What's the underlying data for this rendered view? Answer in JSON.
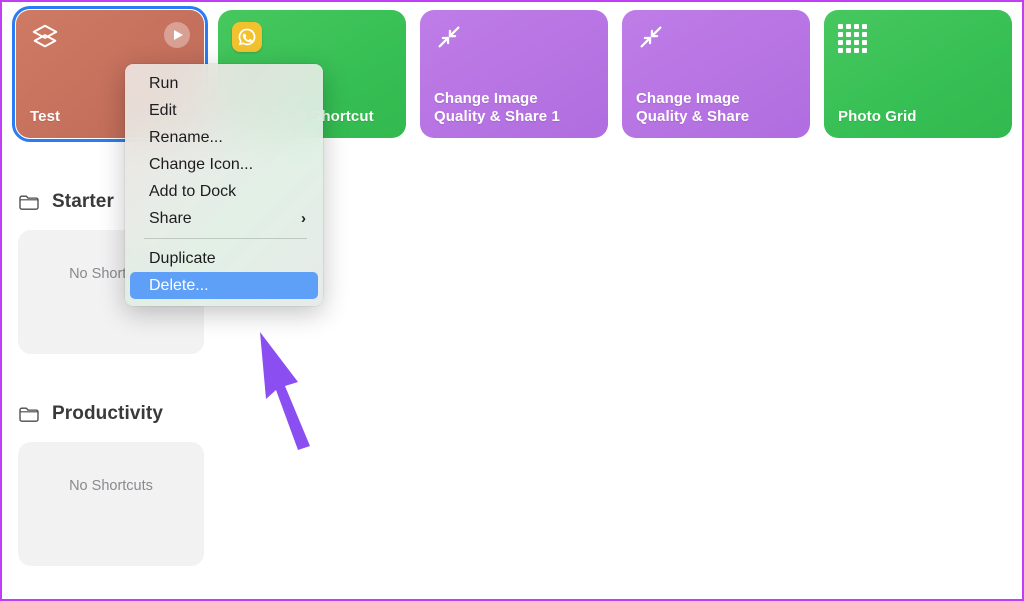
{
  "window": {
    "border_color": "#c13ef5",
    "background": "#ffffff"
  },
  "shortcuts": [
    {
      "title": "Test",
      "color": "#c4705c",
      "color_name": "salmon",
      "icon": "layers-icon",
      "badge": "play-icon",
      "selected": true
    },
    {
      "title": "WhatsApp Shortcut",
      "color": "#36bf54",
      "color_name": "green",
      "icon": "whatsapp-icon",
      "badge": "",
      "selected": false
    },
    {
      "title": "Change Image\nQuality & Share 1",
      "color": "#b673e2",
      "color_name": "purple",
      "icon": "compress-arrows-icon",
      "badge": "",
      "selected": false
    },
    {
      "title": "Change Image\nQuality & Share",
      "color": "#b673e2",
      "color_name": "purple",
      "icon": "compress-arrows-icon",
      "badge": "",
      "selected": false
    },
    {
      "title": "Photo Grid",
      "color": "#36bf54",
      "color_name": "green",
      "icon": "grid-dots-icon",
      "badge": "",
      "selected": false
    }
  ],
  "folders": [
    {
      "name": "Starter",
      "icon": "folder-icon",
      "empty_label": "No Shortcuts"
    },
    {
      "name": "Productivity",
      "icon": "folder-icon",
      "empty_label": "No Shortcuts"
    }
  ],
  "context_menu": {
    "highlight_color": "#5ea0f7",
    "items": [
      {
        "label": "Run",
        "submenu": "",
        "highlighted": false,
        "separator_after": false
      },
      {
        "label": "Edit",
        "submenu": "",
        "highlighted": false,
        "separator_after": false
      },
      {
        "label": "Rename...",
        "submenu": "",
        "highlighted": false,
        "separator_after": false
      },
      {
        "label": "Change Icon...",
        "submenu": "",
        "highlighted": false,
        "separator_after": false
      },
      {
        "label": "Add to Dock",
        "submenu": "",
        "highlighted": false,
        "separator_after": false
      },
      {
        "label": "Share",
        "submenu": "›",
        "highlighted": false,
        "separator_after": true
      },
      {
        "label": "Duplicate",
        "submenu": "",
        "highlighted": false,
        "separator_after": false
      },
      {
        "label": "Delete...",
        "submenu": "",
        "highlighted": true,
        "separator_after": false
      }
    ]
  },
  "annotation": {
    "type": "arrow",
    "color": "#8b4ef0",
    "points_to": "Delete..."
  }
}
